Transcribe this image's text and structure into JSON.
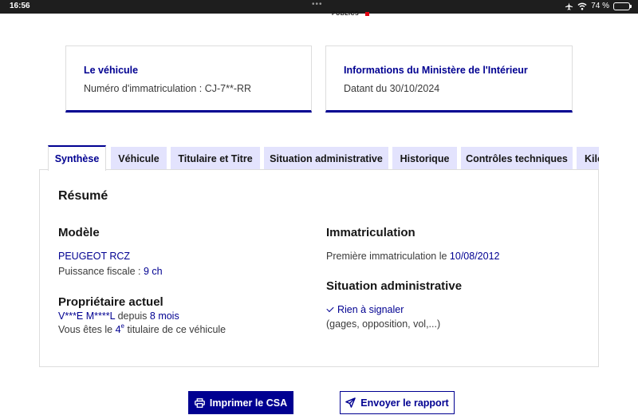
{
  "status_bar": {
    "time": "16:56",
    "dots": "•••",
    "battery": "74 %",
    "battery_level": 0.74
  },
  "header": {
    "logo_text": "PUBLICS"
  },
  "cards": {
    "vehicle": {
      "title": "Le véhicule",
      "line": "Numéro d'immatriculation : CJ-7**-RR"
    },
    "ministry": {
      "title": "Informations du Ministère de l'Intérieur",
      "line": "Datant du 30/10/2024"
    }
  },
  "tabs": [
    "Synthèse",
    "Véhicule",
    "Titulaire et Titre",
    "Situation administrative",
    "Historique",
    "Contrôles techniques",
    "Kilo"
  ],
  "active_tab": "Synthèse",
  "summary": {
    "title": "Résumé",
    "model": {
      "heading": "Modèle",
      "name": "PEUGEOT RCZ",
      "power_label": "Puissance fiscale : ",
      "power_value": "9 ch"
    },
    "owner": {
      "heading": "Propriétaire actuel",
      "name": "V***E M****L",
      "since_label": " depuis ",
      "since_value": "8 mois",
      "rank_prefix": "Vous êtes le ",
      "rank_number": "4",
      "rank_sup": "e",
      "rank_suffix": " titulaire de ce véhicule"
    },
    "registration": {
      "heading": "Immatriculation",
      "first_label": "Première immatriculation le ",
      "first_date": "10/08/2012"
    },
    "admin": {
      "heading": "Situation administrative",
      "status": "Rien à signaler",
      "details": "(gages, opposition, vol,...)"
    }
  },
  "actions": {
    "print": "Imprimer le CSA",
    "send": "Envoyer le rapport"
  }
}
